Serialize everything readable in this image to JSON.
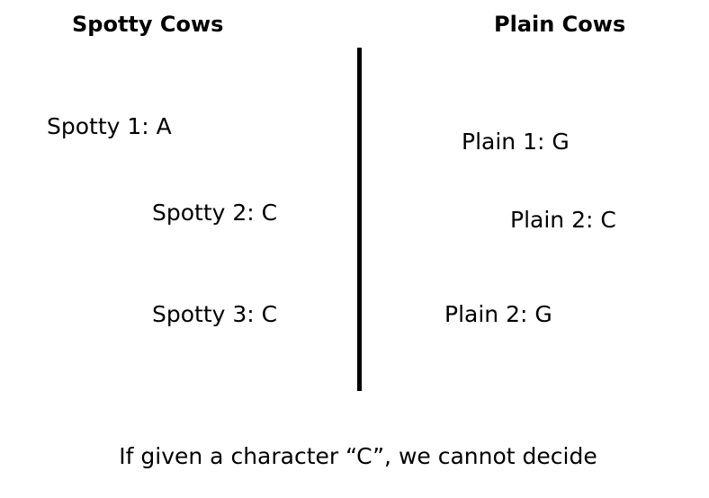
{
  "columns": [
    {
      "title": "Spotty Cows",
      "items": [
        "Spotty 1: A",
        "Spotty 2: C",
        "Spotty 3: C"
      ]
    },
    {
      "title": "Plain Cows",
      "items": [
        "Plain 1: G",
        "Plain 2: C",
        "Plain 2: G"
      ]
    }
  ],
  "caption": "If given a character “C”, we cannot decide"
}
